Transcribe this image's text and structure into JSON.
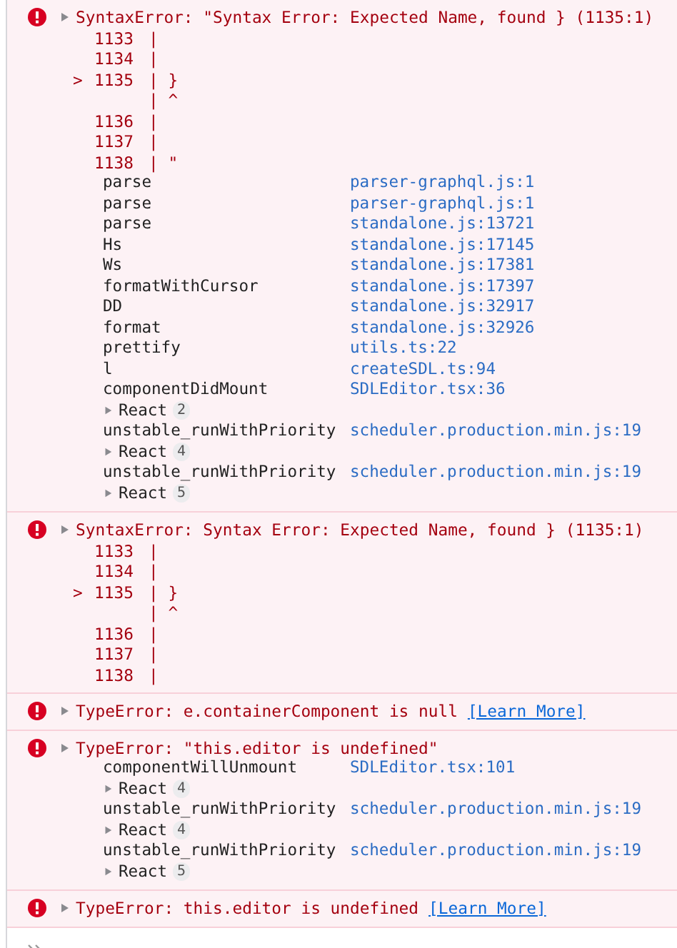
{
  "messages": [
    {
      "text": "SyntaxError: \"Syntax Error: Expected Name, found } (1135:1)",
      "code_frame": [
        {
          "number": "1133",
          "code": "|"
        },
        {
          "number": "1134",
          "code": "|"
        },
        {
          "marker": ">",
          "number": "1135",
          "code": "| }"
        },
        {
          "code": "| ^"
        },
        {
          "number": "1136",
          "code": "|"
        },
        {
          "number": "1137",
          "code": "|"
        },
        {
          "number": "1138",
          "code": "| \""
        }
      ],
      "stack": [
        {
          "kind": "frame",
          "function": "parse",
          "location": "parser-graphql.js:1"
        },
        {
          "kind": "frame",
          "function": "parse",
          "location": "parser-graphql.js:1"
        },
        {
          "kind": "frame",
          "function": "parse",
          "location": "standalone.js:13721"
        },
        {
          "kind": "frame",
          "function": "Hs",
          "location": "standalone.js:17145"
        },
        {
          "kind": "frame",
          "function": "Ws",
          "location": "standalone.js:17381"
        },
        {
          "kind": "frame",
          "function": "formatWithCursor",
          "location": "standalone.js:17397"
        },
        {
          "kind": "frame",
          "function": "DD",
          "location": "standalone.js:32917"
        },
        {
          "kind": "frame",
          "function": "format",
          "location": "standalone.js:32926"
        },
        {
          "kind": "frame",
          "function": "prettify",
          "location": "utils.ts:22"
        },
        {
          "kind": "frame",
          "function": "l",
          "location": "createSDL.ts:94"
        },
        {
          "kind": "frame",
          "function": "componentDidMount",
          "location": "SDLEditor.tsx:36"
        },
        {
          "kind": "group",
          "label": "React",
          "count": "2"
        },
        {
          "kind": "frame",
          "function": "unstable_runWithPriority",
          "location": "scheduler.production.min.js:19"
        },
        {
          "kind": "group",
          "label": "React",
          "count": "4"
        },
        {
          "kind": "frame",
          "function": "unstable_runWithPriority",
          "location": "scheduler.production.min.js:19"
        },
        {
          "kind": "group",
          "label": "React",
          "count": "5"
        }
      ]
    },
    {
      "text": "SyntaxError: Syntax Error: Expected Name, found } (1135:1)",
      "code_frame": [
        {
          "number": "1133",
          "code": "|"
        },
        {
          "number": "1134",
          "code": "|"
        },
        {
          "marker": ">",
          "number": "1135",
          "code": "| }"
        },
        {
          "code": "| ^"
        },
        {
          "number": "1136",
          "code": "|"
        },
        {
          "number": "1137",
          "code": "|"
        },
        {
          "number": "1138",
          "code": "|"
        }
      ]
    },
    {
      "text": "TypeError: e.containerComponent is null",
      "link": "[Learn More]"
    },
    {
      "text": "TypeError: \"this.editor is undefined\"",
      "stack": [
        {
          "kind": "frame",
          "function": "componentWillUnmount",
          "location": "SDLEditor.tsx:101"
        },
        {
          "kind": "group",
          "label": "React",
          "count": "4"
        },
        {
          "kind": "frame",
          "function": "unstable_runWithPriority",
          "location": "scheduler.production.min.js:19"
        },
        {
          "kind": "group",
          "label": "React",
          "count": "4"
        },
        {
          "kind": "frame",
          "function": "unstable_runWithPriority",
          "location": "scheduler.production.min.js:19"
        },
        {
          "kind": "group",
          "label": "React",
          "count": "5"
        }
      ]
    },
    {
      "text": "TypeError: this.editor is undefined",
      "link": "[Learn More]"
    }
  ]
}
